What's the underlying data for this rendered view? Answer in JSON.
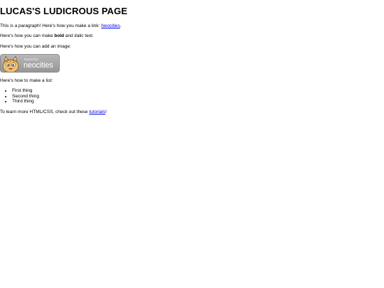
{
  "page": {
    "title": "LUCAS'S LUDICROUS PAGE"
  },
  "paragraph1": {
    "text_before": "This is a paragraph! Here's how you make a link: ",
    "link_text": "Neocities",
    "text_after": "."
  },
  "paragraph2": {
    "text_before": "Here's how you can make ",
    "bold_text": "bold",
    "text_middle": " and ",
    "italic_text": "italic",
    "text_after": " text."
  },
  "paragraph3": {
    "text": "Here's how you can add an image:"
  },
  "image_badge": {
    "hosted_text": "hosted by",
    "brand_text": "neocities",
    "icon": "neocities-cat-icon"
  },
  "paragraph4": {
    "text": "Here's how to make a list:"
  },
  "list": {
    "items": [
      "First thing",
      "Second thing",
      "Third thing"
    ]
  },
  "paragraph5": {
    "text_before": "To learn more HTML/CSS, check out these ",
    "link_text": "tutorials",
    "text_after": "!"
  },
  "colors": {
    "link": "#0000ee",
    "text": "#000000",
    "background": "#ffffff",
    "badge_bg": "#a8a8a8"
  }
}
